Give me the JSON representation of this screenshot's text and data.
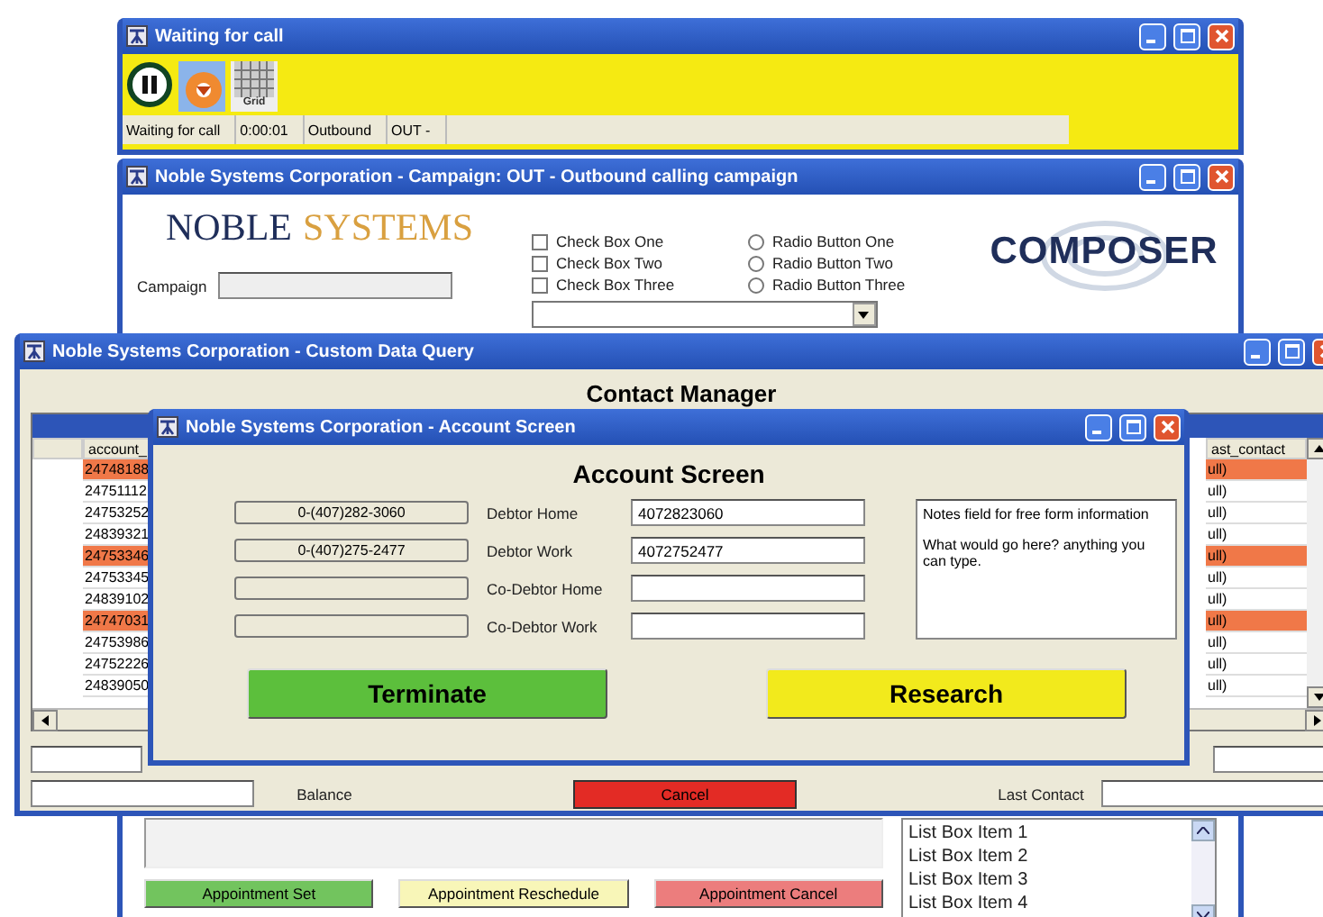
{
  "waiting_window": {
    "title": "Waiting for call",
    "grid_label": "Grid",
    "status": [
      "Waiting for call",
      "0:00:01",
      "Outbound",
      "OUT -"
    ]
  },
  "campaign_window": {
    "title": "Noble Systems Corporation - Campaign: OUT - Outbound calling campaign",
    "logo": [
      "NOBLE",
      "SYSTEMS"
    ],
    "campaign_label": "Campaign",
    "composer_logo": "COMPOSER",
    "checkboxes": [
      {
        "label": "Check Box One",
        "checked": false
      },
      {
        "label": "Check Box Two",
        "checked": false
      },
      {
        "label": "Check Box Three",
        "checked": false
      }
    ],
    "radios": [
      {
        "label": "Radio Button One",
        "selected": false
      },
      {
        "label": "Radio Button Two",
        "selected": false
      },
      {
        "label": "Radio Button Three",
        "selected": false
      }
    ],
    "buttons": [
      {
        "label": "Appointment Set",
        "color": "#72c45e"
      },
      {
        "label": "Appointment Reschedule",
        "color": "#f8f6b8"
      },
      {
        "label": "Appointment Cancel",
        "color": "#ec7d7d"
      }
    ],
    "list_items": [
      "List Box Item 1",
      "List Box Item 2",
      "List Box Item 3",
      "List Box Item 4"
    ]
  },
  "query_window": {
    "title": "Noble Systems Corporation - Custom Data Query",
    "heading": "Contact Manager",
    "columns": [
      "account_",
      "ast_contact"
    ],
    "rows": [
      {
        "account": "24748188",
        "last_contact": "ull)",
        "highlighted": true
      },
      {
        "account": "24751112",
        "last_contact": "ull)",
        "highlighted": false
      },
      {
        "account": "24753252",
        "last_contact": "ull)",
        "highlighted": false
      },
      {
        "account": "24839321",
        "last_contact": "ull)",
        "highlighted": false
      },
      {
        "account": "24753346",
        "last_contact": "ull)",
        "highlighted": true
      },
      {
        "account": "24753345",
        "last_contact": "ull)",
        "highlighted": false
      },
      {
        "account": "24839102",
        "last_contact": "ull)",
        "highlighted": false
      },
      {
        "account": "24747031",
        "last_contact": "ull)",
        "highlighted": true
      },
      {
        "account": "24753986",
        "last_contact": "ull)",
        "highlighted": false
      },
      {
        "account": "24752226",
        "last_contact": "ull)",
        "highlighted": false
      },
      {
        "account": "24839050",
        "last_contact": "ull)",
        "highlighted": false
      }
    ],
    "balance_label": "Balance",
    "cancel": "Cancel",
    "last_contact_label": "Last Contact"
  },
  "account_window": {
    "title": "Noble Systems Corporation - Account Screen",
    "heading": "Account Screen",
    "rows": [
      {
        "phone": "0-(407)282-3060",
        "label": "Debtor Home",
        "value": "4072823060"
      },
      {
        "phone": "0-(407)275-2477",
        "label": "Debtor Work",
        "value": "4072752477"
      },
      {
        "label": "Co-Debtor Home"
      },
      {
        "label": "Co-Debtor Work"
      }
    ],
    "notes": [
      "Notes field for free form information",
      "What would go here?  anything you can type."
    ],
    "buttons": [
      {
        "label": "Terminate",
        "color": "#5cbf3c"
      },
      {
        "label": "Research",
        "color": "#f2ea1c"
      }
    ]
  }
}
